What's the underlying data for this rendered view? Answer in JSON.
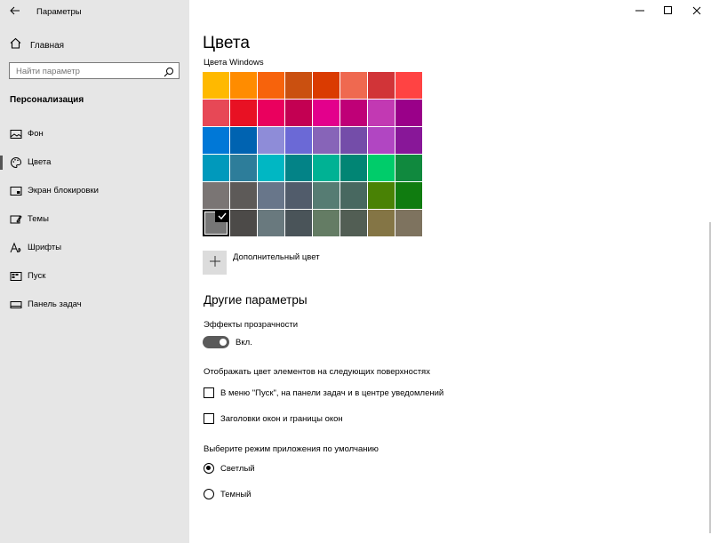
{
  "window": {
    "title": "Параметры"
  },
  "sidebar": {
    "home_label": "Главная",
    "search_placeholder": "Найти параметр",
    "section_title": "Персонализация",
    "items": [
      {
        "label": "Фон",
        "icon": "picture-icon"
      },
      {
        "label": "Цвета",
        "icon": "palette-icon",
        "active": true
      },
      {
        "label": "Экран блокировки",
        "icon": "lock-screen-icon"
      },
      {
        "label": "Темы",
        "icon": "themes-icon"
      },
      {
        "label": "Шрифты",
        "icon": "fonts-icon"
      },
      {
        "label": "Пуск",
        "icon": "start-icon"
      },
      {
        "label": "Панель задач",
        "icon": "taskbar-icon"
      }
    ]
  },
  "main": {
    "title": "Цвета",
    "windows_colors_label": "Цвета Windows",
    "swatch_colors": [
      [
        "#FFB900",
        "#FF8C00",
        "#F7630C",
        "#CA5010",
        "#DA3B01",
        "#EF6950",
        "#D13438",
        "#FF4343"
      ],
      [
        "#E74856",
        "#E81123",
        "#EA005E",
        "#C30052",
        "#E3008C",
        "#BF0077",
        "#C239B3",
        "#9A0089"
      ],
      [
        "#0078D7",
        "#0063B1",
        "#8E8CD8",
        "#6B69D6",
        "#8764B8",
        "#744DA9",
        "#B146C2",
        "#881798"
      ],
      [
        "#0099BC",
        "#2D7D9A",
        "#00B7C3",
        "#038387",
        "#00B294",
        "#018574",
        "#00CC6A",
        "#10893E"
      ],
      [
        "#7A7574",
        "#5D5A58",
        "#68768A",
        "#515C6B",
        "#567C73",
        "#486860",
        "#498205",
        "#107C10"
      ],
      [
        "#767676",
        "#4C4A48",
        "#69797E",
        "#4A5459",
        "#647C64",
        "#525E54",
        "#847545",
        "#7E735F"
      ]
    ],
    "selected_swatch": {
      "row": 5,
      "col": 0
    },
    "custom_color_label": "Дополнительный цвет",
    "other_params_title": "Другие параметры",
    "transparency_label": "Эффекты прозрачности",
    "transparency_state": "Вкл.",
    "transparency_on": true,
    "surfaces_label": "Отображать цвет элементов на следующих поверхностях",
    "checkbox_start": "В меню \"Пуск\", на панели задач и в центре уведомлений",
    "checkbox_titlebars": "Заголовки окон и границы окон",
    "app_mode_label": "Выберите режим приложения по умолчанию",
    "mode_light": "Светлый",
    "mode_dark": "Темный",
    "mode_selected": "light"
  }
}
